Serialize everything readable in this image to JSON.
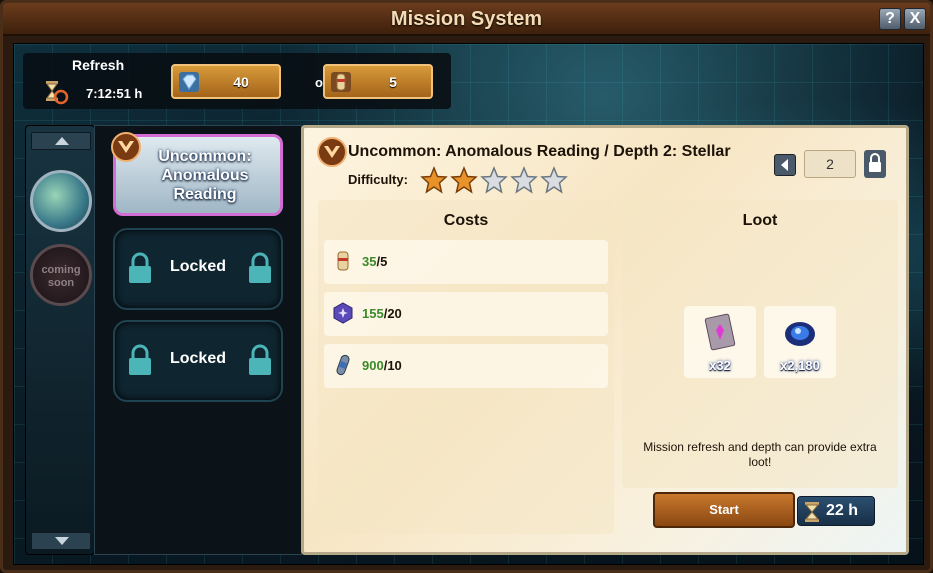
{
  "window": {
    "title": "Mission System",
    "help_label": "?",
    "close_label": "X"
  },
  "refresh": {
    "label": "Refresh",
    "timer": "7:12:51 h",
    "diamond_cost": "40",
    "or_label": "or",
    "scroll_cost": "5"
  },
  "sidebar": {
    "coming_soon_label": "coming soon"
  },
  "missions": [
    {
      "label": "Uncommon: Anomalous Reading",
      "state": "active"
    },
    {
      "label": "Locked",
      "state": "locked"
    },
    {
      "label": "Locked",
      "state": "locked"
    }
  ],
  "detail": {
    "title": "Uncommon: Anomalous Reading / Depth 2: Stellar",
    "difficulty_label": "Difficulty:",
    "difficulty_stars": 2,
    "difficulty_max": 5,
    "depth_value": "2",
    "costs_heading": "Costs",
    "costs": [
      {
        "icon": "scroll-icon",
        "have": "35",
        "need": "/5"
      },
      {
        "icon": "hexagon-gem-icon",
        "have": "155",
        "need": "/20"
      },
      {
        "icon": "capsule-icon",
        "have": "900",
        "need": "/10"
      }
    ],
    "loot_heading": "Loot",
    "loot": [
      {
        "icon": "card-shard-icon",
        "qty": "x32"
      },
      {
        "icon": "stellar-dust-icon",
        "qty": "x2,180"
      }
    ],
    "loot_note": "Mission refresh and depth can provide extra loot!",
    "start_label": "Start",
    "duration": "22 h"
  },
  "colors": {
    "accent": "#d36cd3",
    "have_green": "#3b8a2a",
    "button_orange": "#c9782d"
  }
}
